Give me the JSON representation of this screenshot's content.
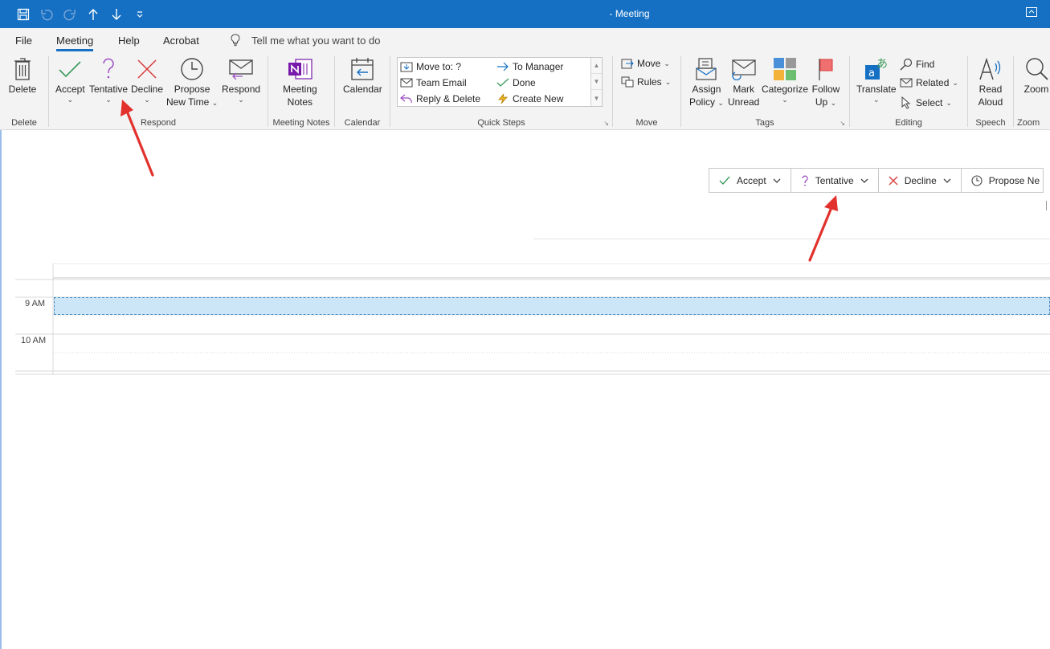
{
  "window": {
    "title": "- Meeting"
  },
  "menu": {
    "file": "File",
    "meeting": "Meeting",
    "help": "Help",
    "acrobat": "Acrobat",
    "tellme": "Tell me what you want to do"
  },
  "ribbon": {
    "delete": {
      "label": "Delete",
      "group": "Delete"
    },
    "respond": {
      "accept": "Accept",
      "tentative": "Tentative",
      "decline": "Decline",
      "propose1": "Propose",
      "propose2": "New Time",
      "respond": "Respond",
      "group": "Respond"
    },
    "meeting_notes": {
      "label1": "Meeting",
      "label2": "Notes",
      "group": "Meeting Notes"
    },
    "calendar": {
      "label": "Calendar",
      "group": "Calendar"
    },
    "quick_steps": {
      "move_to": "Move to: ?",
      "team_email": "Team Email",
      "reply_delete": "Reply & Delete",
      "to_manager": "To Manager",
      "done": "Done",
      "create_new": "Create New",
      "group": "Quick Steps"
    },
    "move": {
      "move": "Move",
      "rules": "Rules",
      "group": "Move"
    },
    "tags": {
      "assign1": "Assign",
      "assign2": "Policy",
      "mark1": "Mark",
      "mark2": "Unread",
      "categorize": "Categorize",
      "follow1": "Follow",
      "follow2": "Up",
      "group": "Tags"
    },
    "editing": {
      "translate": "Translate",
      "find": "Find",
      "related": "Related",
      "select": "Select",
      "group": "Editing"
    },
    "speech": {
      "read1": "Read",
      "read2": "Aloud",
      "group": "Speech"
    },
    "zoom": {
      "label": "Zoom",
      "group": "Zoom"
    }
  },
  "respond_bar": {
    "accept": "Accept",
    "tentative": "Tentative",
    "decline": "Decline",
    "propose": "Propose Ne"
  },
  "calendar_view": {
    "time_9": "9 AM",
    "time_10": "10 AM"
  },
  "colors": {
    "accent": "#1570c4",
    "accept": "#3a9b5c",
    "tentative": "#9b4fc0",
    "decline": "#d9393a",
    "selection": "#cde6f7",
    "annotation": "#e2312d"
  }
}
